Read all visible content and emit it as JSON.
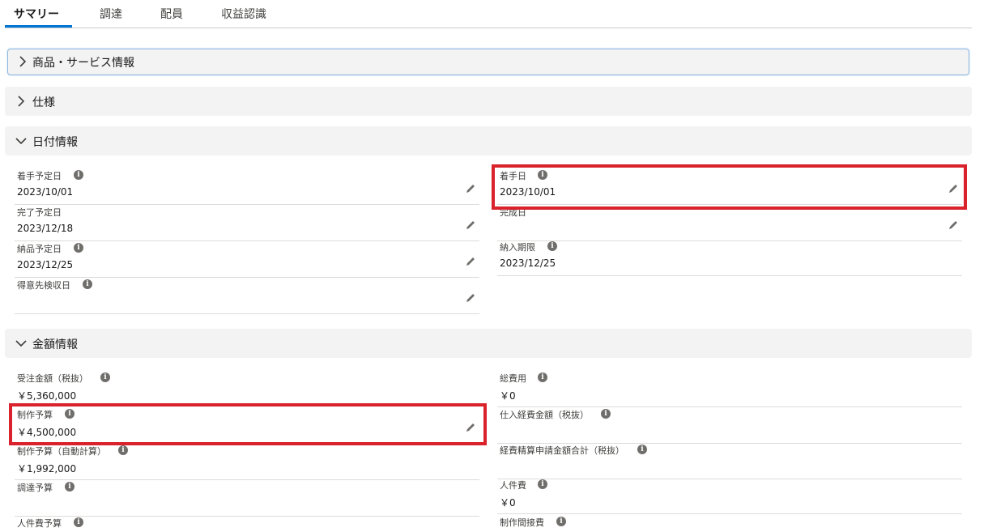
{
  "tabs": [
    {
      "label": "サマリー",
      "active": true
    },
    {
      "label": "調達"
    },
    {
      "label": "配員"
    },
    {
      "label": "収益認識"
    }
  ],
  "sections": {
    "product": {
      "title": "商品・サービス情報",
      "expanded": false
    },
    "spec": {
      "title": "仕様",
      "expanded": false
    },
    "date": {
      "title": "日付情報",
      "expanded": true
    },
    "amount": {
      "title": "金額情報",
      "expanded": true
    }
  },
  "date_fields": {
    "left": [
      {
        "label": "着手予定日",
        "value": "2023/10/01",
        "info": true,
        "editable": true
      },
      {
        "label": "完了予定日",
        "value": "2023/12/18",
        "info": false,
        "editable": true
      },
      {
        "label": "納品予定日",
        "value": "2023/12/25",
        "info": true,
        "editable": true
      },
      {
        "label": "得意先検収日",
        "value": "",
        "info": true,
        "editable": true
      }
    ],
    "right": [
      {
        "label": "着手日",
        "value": "2023/10/01",
        "info": true,
        "editable": true,
        "highlighted": true
      },
      {
        "label": "完成日",
        "value": "",
        "info": false,
        "editable": true
      },
      {
        "label": "納入期限",
        "value": "2023/12/25",
        "info": true,
        "editable": false
      }
    ]
  },
  "amount_fields": {
    "left": [
      {
        "label": "受注金額（税抜）",
        "value": "￥5,360,000",
        "info": true,
        "editable": false
      },
      {
        "label": "制作予算",
        "value": "￥4,500,000",
        "info": true,
        "editable": true,
        "highlighted": true
      },
      {
        "label": "制作予算（自動計算）",
        "value": "￥1,992,000",
        "info": true,
        "editable": false
      },
      {
        "label": "調達予算",
        "value": "",
        "info": true,
        "editable": false
      },
      {
        "label": "人件費予算",
        "value": "",
        "info": true,
        "editable": false
      }
    ],
    "right": [
      {
        "label": "総費用",
        "value": "￥0",
        "info": true,
        "editable": false
      },
      {
        "label": "仕入経費金額（税抜）",
        "value": "",
        "info": true,
        "editable": false
      },
      {
        "label": "経費精算申請金額合計（税抜）",
        "value": "",
        "info": true,
        "editable": false
      },
      {
        "label": "人件費",
        "value": "￥0",
        "info": true,
        "editable": false
      },
      {
        "label": "制作間接費",
        "value": "",
        "info": true,
        "editable": false
      }
    ]
  },
  "colors": {
    "highlight": "#d9222b",
    "accent": "#0176d3"
  },
  "icons": {
    "info": "info-icon",
    "edit": "pencil-icon",
    "collapsed": "chevron-right-icon",
    "expanded": "chevron-down-icon"
  }
}
